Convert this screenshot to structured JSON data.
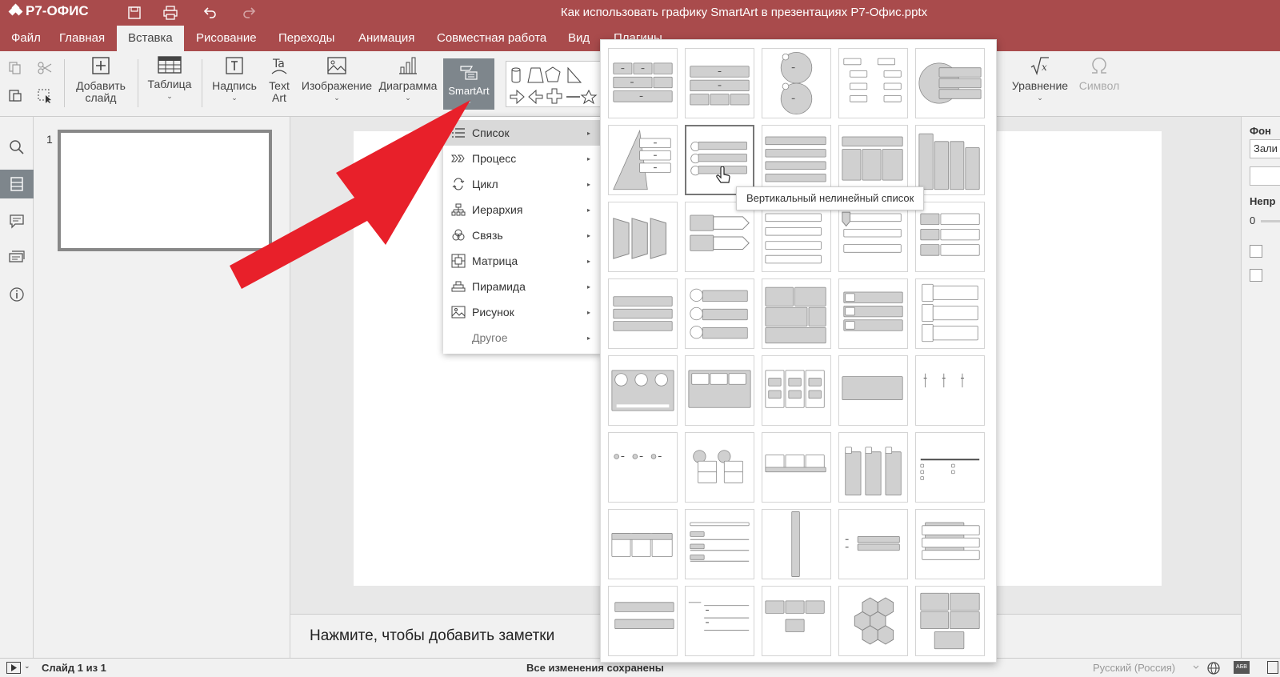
{
  "app": {
    "brand": "Р7-ОФИС",
    "doc_title": "Как использовать графику SmartArt в презентациях Р7-Офис.pptx"
  },
  "menu": {
    "tabs": [
      "Файл",
      "Главная",
      "Вставка",
      "Рисование",
      "Переходы",
      "Анимация",
      "Совместная работа",
      "Вид",
      "Плагины"
    ],
    "active_tab": "Вставка"
  },
  "ribbon": {
    "add_slide": "Добавить слайд",
    "table": "Таблица",
    "textbox": "Надпись",
    "textart": "Text Art",
    "image": "Изображение",
    "chart": "Диаграмма",
    "smartart": "SmartArt",
    "equation": "Уравнение",
    "symbol": "Символ"
  },
  "smartart_menu": {
    "items": [
      {
        "label": "Список",
        "icon": "list-icon"
      },
      {
        "label": "Процесс",
        "icon": "process-icon"
      },
      {
        "label": "Цикл",
        "icon": "cycle-icon"
      },
      {
        "label": "Иерархия",
        "icon": "hierarchy-icon"
      },
      {
        "label": "Связь",
        "icon": "relationship-icon"
      },
      {
        "label": "Матрица",
        "icon": "matrix-icon"
      },
      {
        "label": "Пирамида",
        "icon": "pyramid-icon"
      },
      {
        "label": "Рисунок",
        "icon": "picture-icon"
      },
      {
        "label": "Другое",
        "icon": ""
      }
    ],
    "active": "Список"
  },
  "gallery": {
    "tooltip": "Вертикальный нелинейный список"
  },
  "thumbnails": {
    "slide_number": "1"
  },
  "notes": {
    "placeholder": "Нажмите, чтобы добавить заметки"
  },
  "right_panel": {
    "background_label": "Фон",
    "fill_value": "Зали",
    "opacity_label": "Непр",
    "opacity_value": "0"
  },
  "status": {
    "slide_of": "Слайд 1 из 1",
    "saved": "Все изменения сохранены",
    "language": "Русский (Россия)",
    "spell_icon": "АБВ"
  },
  "colors": {
    "accent": "#a94b4c",
    "arrow": "#e8202a",
    "active_button": "#7e868c"
  }
}
